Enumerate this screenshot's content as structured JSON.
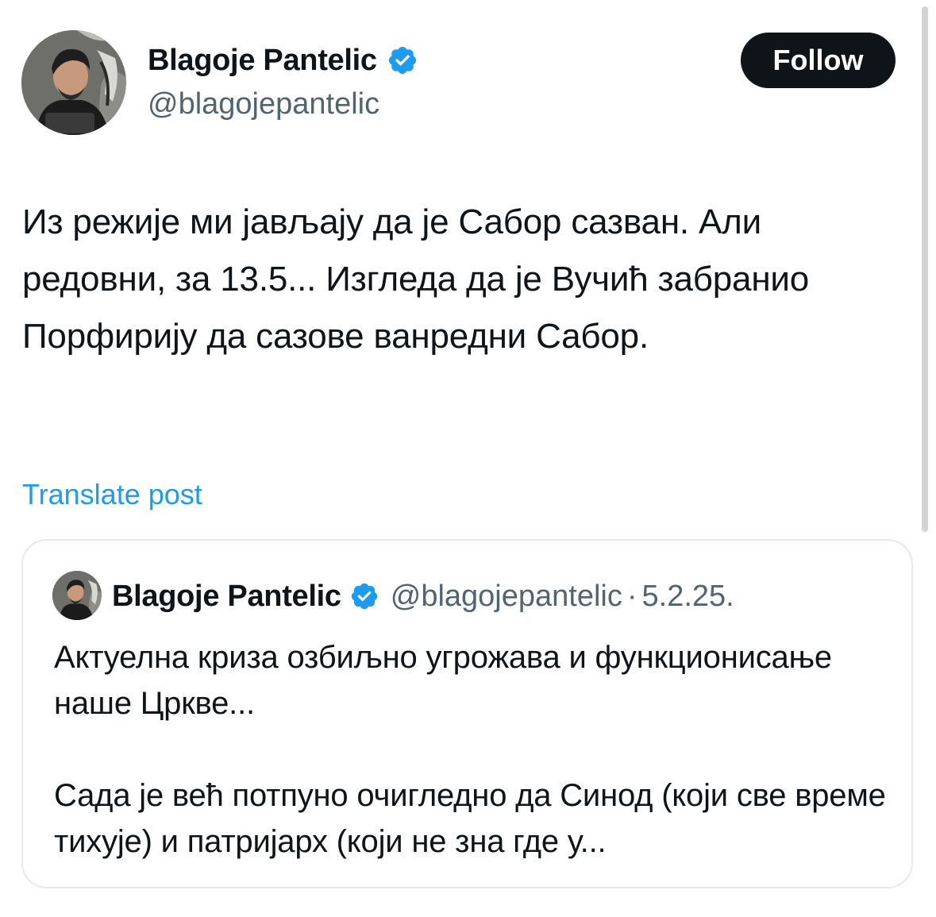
{
  "colors": {
    "text": "#0f1419",
    "secondary_text": "#536471",
    "link": "#1d9bf0",
    "verified_badge": "#1d9bf0",
    "follow_button_bg": "#0f1419",
    "follow_button_text": "#ffffff",
    "border": "#e7e9ea"
  },
  "author": {
    "name": "Blagoje Pantelic",
    "handle": "@blagojepantelic",
    "avatar_icon": "profile-photo",
    "badge_icon": "verified-badge-icon"
  },
  "follow": {
    "label": "Follow"
  },
  "post": {
    "text": "Из режије ми јављају да је Сабор сазван. Али редовни, за 13.5... Изгледа да је Вучић забранио Порфирију да сазове ванредни Сабор.",
    "translate_label": "Translate post"
  },
  "quote": {
    "name": "Blagoje Pantelic",
    "handle": "@blagojepantelic",
    "separator": "·",
    "date": "5.2.25.",
    "text": "Актуелна криза озбиљно угрожава и функционисање наше Цркве...\n\nСада је већ потпуно очигледно да Синод (који све време тихује) и патријарх (који не зна где у..."
  }
}
